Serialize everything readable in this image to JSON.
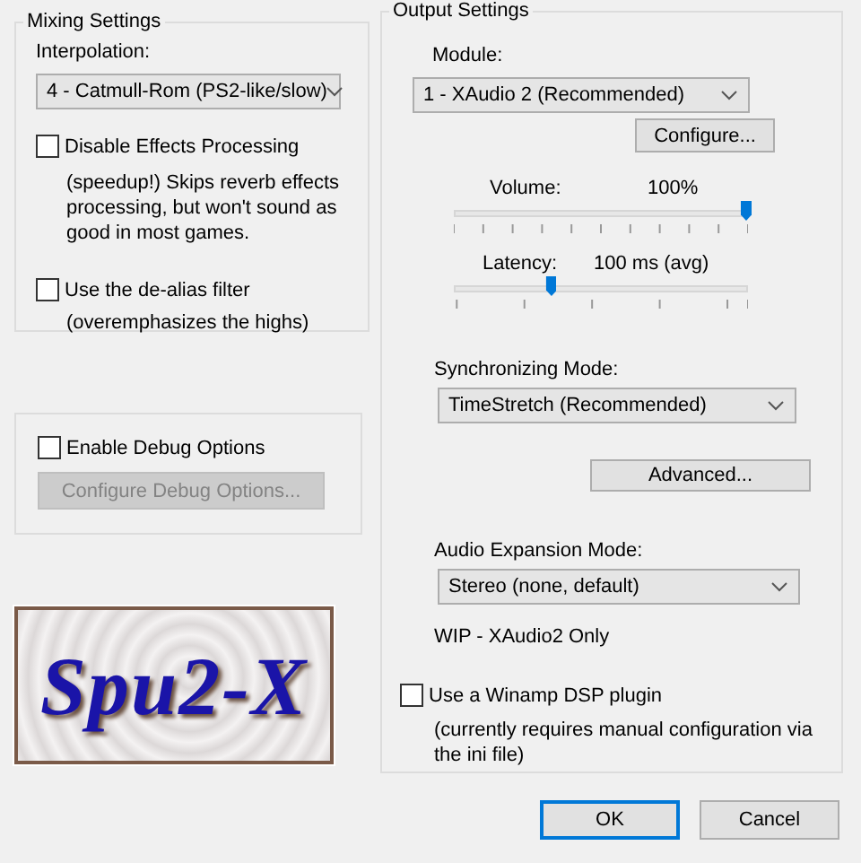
{
  "mixing_settings": {
    "title": "Mixing Settings",
    "interpolation_label": "Interpolation:",
    "interpolation": "4 - Catmull-Rom (PS2-like/slow)",
    "options": [
      {
        "label": "Disable Effects Processing",
        "checked": false,
        "description": "(speedup!) Skips reverb effects processing, but won't sound as good in most games."
      },
      {
        "label": "Use the de-alias filter",
        "checked": false,
        "description": "(overemphasizes the highs)"
      }
    ]
  },
  "debug": {
    "label": "Enable Debug Options",
    "checked": false,
    "button": {
      "label": "Configure Debug Options...",
      "disabled": true
    }
  },
  "logo": {
    "text": "Spu2-X"
  },
  "output_settings": {
    "title": "Output Settings",
    "module_label": "Module:",
    "module": "1 - XAudio 2 (Recommended)",
    "configure_button": "Configure...",
    "volume": {
      "label": "Volume:",
      "reading": "100%",
      "level": 1.0
    },
    "latency": {
      "label": "Latency:",
      "reading": "100 ms (avg)",
      "level": 0.33
    },
    "sync_label": "Synchronizing Mode:",
    "sync_mode": "TimeStretch (Recommended)",
    "advanced_button": "Advanced...",
    "expansion_label": "Audio Expansion Mode:",
    "expansion_mode": "Stereo (none, default)",
    "expansion_note": "WIP - XAudio2 Only",
    "winamp": {
      "label": "Use a Winamp DSP plugin",
      "checked": false,
      "description": "(currently requires manual configuration via the ini file)"
    }
  },
  "buttons": [
    {
      "label": "OK",
      "default": true
    },
    {
      "label": "Cancel",
      "default": false
    }
  ]
}
